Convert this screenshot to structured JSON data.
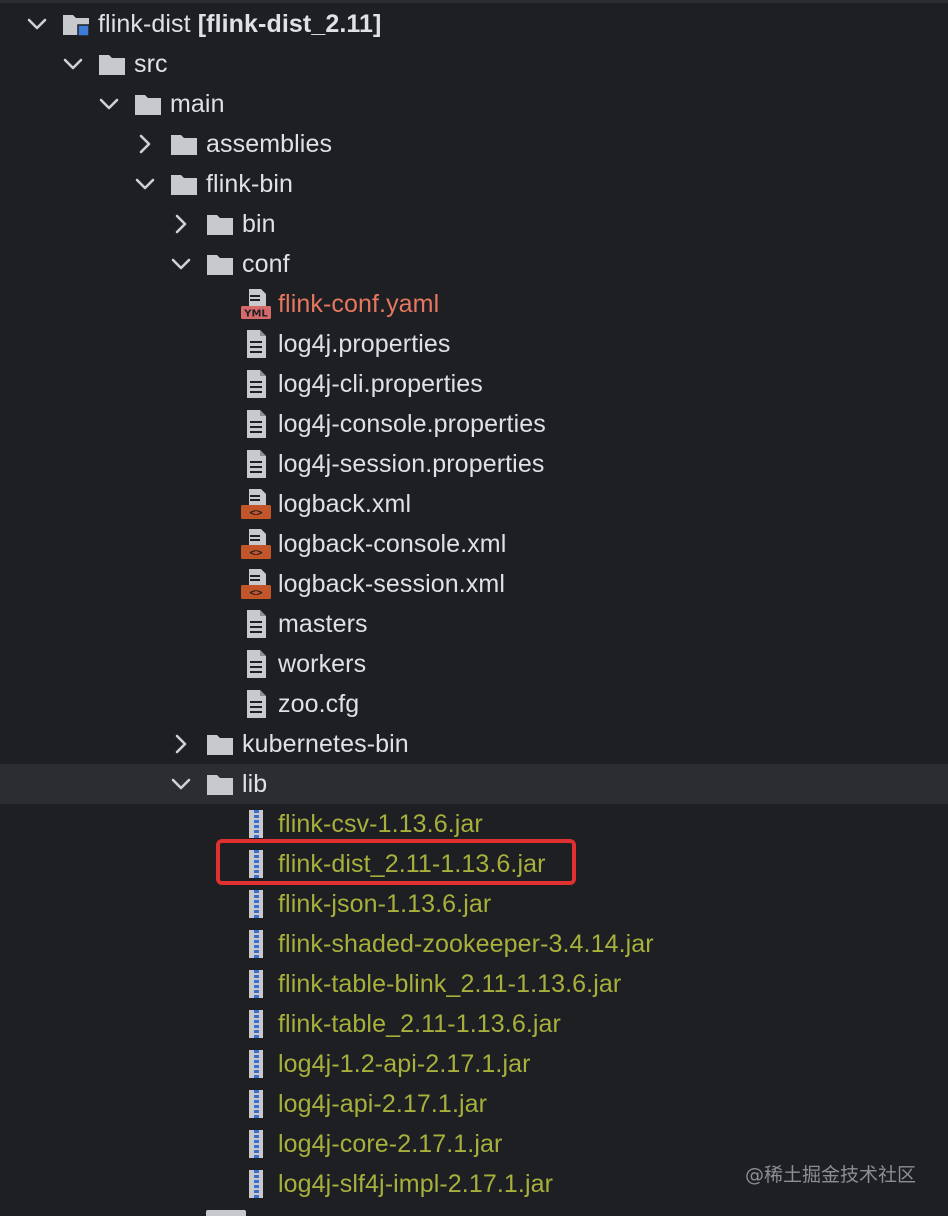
{
  "project_tree": {
    "items": [
      {
        "id": "flink-dist",
        "label": "flink-dist",
        "suffix": "[flink-dist_2.11]",
        "depth": 0,
        "type": "module",
        "arrow": "down"
      },
      {
        "id": "src",
        "label": "src",
        "depth": 1,
        "type": "folder",
        "arrow": "down"
      },
      {
        "id": "main",
        "label": "main",
        "depth": 2,
        "type": "folder",
        "arrow": "down"
      },
      {
        "id": "assemblies",
        "label": "assemblies",
        "depth": 3,
        "type": "folder",
        "arrow": "right"
      },
      {
        "id": "flink-bin",
        "label": "flink-bin",
        "depth": 3,
        "type": "folder",
        "arrow": "down"
      },
      {
        "id": "bin",
        "label": "bin",
        "depth": 4,
        "type": "folder",
        "arrow": "right"
      },
      {
        "id": "conf",
        "label": "conf",
        "depth": 4,
        "type": "folder",
        "arrow": "down"
      },
      {
        "id": "flink-conf-yaml",
        "label": "flink-conf.yaml",
        "depth": 5,
        "type": "yaml",
        "arrow": "none"
      },
      {
        "id": "log4j-properties",
        "label": "log4j.properties",
        "depth": 5,
        "type": "text",
        "arrow": "none"
      },
      {
        "id": "log4j-cli-properties",
        "label": "log4j-cli.properties",
        "depth": 5,
        "type": "text",
        "arrow": "none"
      },
      {
        "id": "log4j-console-properties",
        "label": "log4j-console.properties",
        "depth": 5,
        "type": "text",
        "arrow": "none"
      },
      {
        "id": "log4j-session-properties",
        "label": "log4j-session.properties",
        "depth": 5,
        "type": "text",
        "arrow": "none"
      },
      {
        "id": "logback-xml",
        "label": "logback.xml",
        "depth": 5,
        "type": "xml",
        "arrow": "none"
      },
      {
        "id": "logback-console-xml",
        "label": "logback-console.xml",
        "depth": 5,
        "type": "xml",
        "arrow": "none"
      },
      {
        "id": "logback-session-xml",
        "label": "logback-session.xml",
        "depth": 5,
        "type": "xml",
        "arrow": "none"
      },
      {
        "id": "masters",
        "label": "masters",
        "depth": 5,
        "type": "text",
        "arrow": "none"
      },
      {
        "id": "workers",
        "label": "workers",
        "depth": 5,
        "type": "text",
        "arrow": "none"
      },
      {
        "id": "zoo-cfg",
        "label": "zoo.cfg",
        "depth": 5,
        "type": "text",
        "arrow": "none"
      },
      {
        "id": "kubernetes-bin",
        "label": "kubernetes-bin",
        "depth": 4,
        "type": "folder",
        "arrow": "right"
      },
      {
        "id": "lib",
        "label": "lib",
        "depth": 4,
        "type": "folder",
        "arrow": "down",
        "selected": true
      },
      {
        "id": "flink-csv-jar",
        "label": "flink-csv-1.13.6.jar",
        "depth": 5,
        "type": "jar",
        "arrow": "none"
      },
      {
        "id": "flink-dist-jar",
        "label": "flink-dist_2.11-1.13.6.jar",
        "depth": 5,
        "type": "jar",
        "arrow": "none",
        "boxed": true
      },
      {
        "id": "flink-json-jar",
        "label": "flink-json-1.13.6.jar",
        "depth": 5,
        "type": "jar",
        "arrow": "none"
      },
      {
        "id": "flink-shaded-zookeeper-jar",
        "label": "flink-shaded-zookeeper-3.4.14.jar",
        "depth": 5,
        "type": "jar",
        "arrow": "none"
      },
      {
        "id": "flink-table-blink-jar",
        "label": "flink-table-blink_2.11-1.13.6.jar",
        "depth": 5,
        "type": "jar",
        "arrow": "none"
      },
      {
        "id": "flink-table-jar",
        "label": "flink-table_2.11-1.13.6.jar",
        "depth": 5,
        "type": "jar",
        "arrow": "none"
      },
      {
        "id": "log4j-1-2-api-jar",
        "label": "log4j-1.2-api-2.17.1.jar",
        "depth": 5,
        "type": "jar",
        "arrow": "none"
      },
      {
        "id": "log4j-api-jar",
        "label": "log4j-api-2.17.1.jar",
        "depth": 5,
        "type": "jar",
        "arrow": "none"
      },
      {
        "id": "log4j-core-jar",
        "label": "log4j-core-2.17.1.jar",
        "depth": 5,
        "type": "jar",
        "arrow": "none"
      },
      {
        "id": "log4j-slf4j-impl-jar",
        "label": "log4j-slf4j-impl-2.17.1.jar",
        "depth": 5,
        "type": "jar",
        "arrow": "none"
      }
    ]
  },
  "icons": {
    "yaml_badge": "YML",
    "xml_badge": "<>"
  },
  "watermark": "@稀土掘金技术社区",
  "colors": {
    "background": "#1e1f22",
    "selected_row": "#2b2d30",
    "text": "#dfe1e5",
    "yaml_text": "#e67760",
    "jar_text": "#a8b03c",
    "highlight_border": "#e03030"
  }
}
